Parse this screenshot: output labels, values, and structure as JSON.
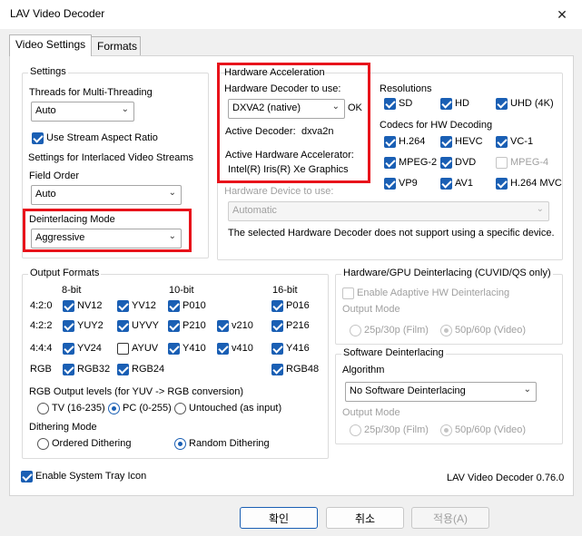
{
  "window": {
    "title": "LAV Video Decoder",
    "close_glyph": "✕"
  },
  "tabs": [
    {
      "label": "Video Settings"
    },
    {
      "label": "Formats"
    }
  ],
  "settings": {
    "title": "Settings",
    "threads_label": "Threads for Multi-Threading",
    "threads_value": "Auto",
    "stream_aspect": "Use Stream Aspect Ratio",
    "interlaced_label": "Settings for Interlaced Video Streams",
    "field_order_label": "Field Order",
    "field_order_value": "Auto",
    "deint_mode_label": "Deinterlacing Mode",
    "deint_mode_value": "Aggressive"
  },
  "hwaccel": {
    "title": "Hardware Acceleration",
    "decoder_label": "Hardware Decoder to use:",
    "decoder_value": "DXVA2 (native)",
    "ok_label": "OK",
    "active_decoder_label": "Active Decoder:",
    "active_decoder_value": "dxva2n",
    "active_accel_label": "Active Hardware Accelerator:",
    "active_accel_value": "Intel(R) Iris(R) Xe Graphics",
    "device_label": "Hardware Device to use:",
    "device_value": "Automatic",
    "note": "The selected Hardware Decoder does not support using a specific device."
  },
  "resolutions": {
    "title": "Resolutions",
    "items": [
      {
        "label": "SD"
      },
      {
        "label": "HD"
      },
      {
        "label": "UHD (4K)"
      }
    ]
  },
  "codecs": {
    "title": "Codecs for HW Decoding",
    "items": [
      {
        "label": "H.264"
      },
      {
        "label": "HEVC"
      },
      {
        "label": "VC-1"
      },
      {
        "label": "MPEG-2"
      },
      {
        "label": "DVD"
      },
      {
        "label": "MPEG-4"
      },
      {
        "label": "VP9"
      },
      {
        "label": "AV1"
      },
      {
        "label": "H.264 MVC"
      }
    ]
  },
  "output_formats": {
    "title": "Output Formats",
    "col_headers": [
      "8-bit",
      "10-bit",
      "16-bit"
    ],
    "row_labels": [
      "4:2:0",
      "4:2:2",
      "4:4:4",
      "RGB"
    ],
    "formats": [
      {
        "label": "NV12"
      },
      {
        "label": "YV12"
      },
      {
        "label": "P010"
      },
      {
        "label": "P016"
      },
      {
        "label": "YUY2"
      },
      {
        "label": "UYVY"
      },
      {
        "label": "P210"
      },
      {
        "label": "v210"
      },
      {
        "label": "P216"
      },
      {
        "label": "YV24"
      },
      {
        "label": "AYUV"
      },
      {
        "label": "Y410"
      },
      {
        "label": "v410"
      },
      {
        "label": "Y416"
      },
      {
        "label": "RGB32"
      },
      {
        "label": "RGB24"
      },
      {
        "label": "RGB48"
      }
    ],
    "rgb_levels_label": "RGB Output levels (for YUV -> RGB conversion)",
    "rgb_levels": [
      {
        "label": "TV (16-235)"
      },
      {
        "label": "PC (0-255)"
      },
      {
        "label": "Untouched (as input)"
      }
    ],
    "dither_label": "Dithering Mode",
    "dither": [
      {
        "label": "Ordered Dithering"
      },
      {
        "label": "Random Dithering"
      }
    ]
  },
  "hw_deint": {
    "title": "Hardware/GPU Deinterlacing (CUVID/QS only)",
    "adaptive": "Enable Adaptive HW Deinterlacing",
    "output_mode_label": "Output Mode",
    "modes": [
      {
        "label": "25p/30p (Film)"
      },
      {
        "label": "50p/60p (Video)"
      }
    ]
  },
  "sw_deint": {
    "title": "Software Deinterlacing",
    "algorithm_label": "Algorithm",
    "algorithm_value": "No Software Deinterlacing",
    "output_mode_label": "Output Mode",
    "modes": [
      {
        "label": "25p/30p (Film)"
      },
      {
        "label": "50p/60p (Video)"
      }
    ]
  },
  "tray_icon": "Enable System Tray Icon",
  "version": "LAV Video Decoder 0.76.0",
  "buttons": {
    "ok": "확인",
    "cancel": "취소",
    "apply": "적용(A)"
  },
  "colors": {
    "accent": "#1a5fb4",
    "highlight_frame": "#e8131b"
  }
}
